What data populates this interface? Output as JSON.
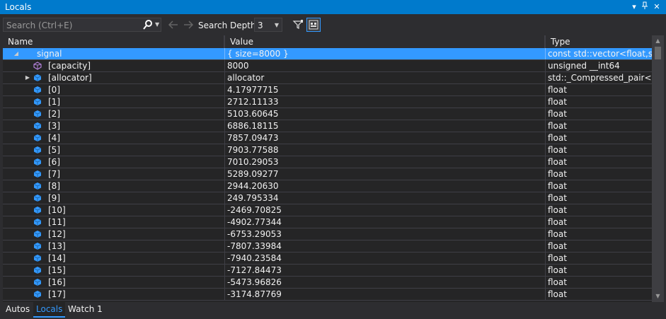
{
  "window": {
    "title": "Locals",
    "controls": [
      "dropdown",
      "pin",
      "close"
    ]
  },
  "toolbar": {
    "search_placeholder": "Search (Ctrl+E)",
    "search_depth_label": "Search Depth:",
    "search_depth_value": "3"
  },
  "columns": {
    "name": "Name",
    "value": "Value",
    "type": "Type"
  },
  "rows": [
    {
      "name": "signal",
      "value": "{ size=8000 }",
      "type": "const std::vector<float,st...",
      "icon": "struct-icon",
      "expander": "expanded",
      "level": 0,
      "selected": true
    },
    {
      "name": "[capacity]",
      "value": "8000",
      "type": "unsigned __int64",
      "icon": "property-icon",
      "expander": "none",
      "level": 1,
      "selected": false
    },
    {
      "name": "[allocator]",
      "value": "allocator",
      "type": "std::_Compressed_pair<st...",
      "icon": "field-icon",
      "expander": "collapsed",
      "level": 1,
      "selected": false
    },
    {
      "name": "[0]",
      "value": "4.17977715",
      "type": "float",
      "icon": "field-icon",
      "expander": "none",
      "level": 1,
      "selected": false
    },
    {
      "name": "[1]",
      "value": "2712.11133",
      "type": "float",
      "icon": "field-icon",
      "expander": "none",
      "level": 1,
      "selected": false
    },
    {
      "name": "[2]",
      "value": "5103.60645",
      "type": "float",
      "icon": "field-icon",
      "expander": "none",
      "level": 1,
      "selected": false
    },
    {
      "name": "[3]",
      "value": "6886.18115",
      "type": "float",
      "icon": "field-icon",
      "expander": "none",
      "level": 1,
      "selected": false
    },
    {
      "name": "[4]",
      "value": "7857.09473",
      "type": "float",
      "icon": "field-icon",
      "expander": "none",
      "level": 1,
      "selected": false
    },
    {
      "name": "[5]",
      "value": "7903.77588",
      "type": "float",
      "icon": "field-icon",
      "expander": "none",
      "level": 1,
      "selected": false
    },
    {
      "name": "[6]",
      "value": "7010.29053",
      "type": "float",
      "icon": "field-icon",
      "expander": "none",
      "level": 1,
      "selected": false
    },
    {
      "name": "[7]",
      "value": "5289.09277",
      "type": "float",
      "icon": "field-icon",
      "expander": "none",
      "level": 1,
      "selected": false
    },
    {
      "name": "[8]",
      "value": "2944.20630",
      "type": "float",
      "icon": "field-icon",
      "expander": "none",
      "level": 1,
      "selected": false
    },
    {
      "name": "[9]",
      "value": "249.795334",
      "type": "float",
      "icon": "field-icon",
      "expander": "none",
      "level": 1,
      "selected": false
    },
    {
      "name": "[10]",
      "value": "-2469.70825",
      "type": "float",
      "icon": "field-icon",
      "expander": "none",
      "level": 1,
      "selected": false
    },
    {
      "name": "[11]",
      "value": "-4902.77344",
      "type": "float",
      "icon": "field-icon",
      "expander": "none",
      "level": 1,
      "selected": false
    },
    {
      "name": "[12]",
      "value": "-6753.29053",
      "type": "float",
      "icon": "field-icon",
      "expander": "none",
      "level": 1,
      "selected": false
    },
    {
      "name": "[13]",
      "value": "-7807.33984",
      "type": "float",
      "icon": "field-icon",
      "expander": "none",
      "level": 1,
      "selected": false
    },
    {
      "name": "[14]",
      "value": "-7940.23584",
      "type": "float",
      "icon": "field-icon",
      "expander": "none",
      "level": 1,
      "selected": false
    },
    {
      "name": "[15]",
      "value": "-7127.84473",
      "type": "float",
      "icon": "field-icon",
      "expander": "none",
      "level": 1,
      "selected": false
    },
    {
      "name": "[16]",
      "value": "-5473.96826",
      "type": "float",
      "icon": "field-icon",
      "expander": "none",
      "level": 1,
      "selected": false
    },
    {
      "name": "[17]",
      "value": "-3174.87769",
      "type": "float",
      "icon": "field-icon",
      "expander": "none",
      "level": 1,
      "selected": false
    }
  ],
  "tabs": [
    {
      "label": "Autos",
      "active": false
    },
    {
      "label": "Locals",
      "active": true
    },
    {
      "label": "Watch 1",
      "active": false
    }
  ],
  "colors": {
    "accent": "#007acc",
    "selection": "#3399ff",
    "background": "#252526",
    "chrome": "#2d2d30",
    "struct_icon": "#3399ff",
    "property_icon": "#b180d7",
    "field_icon": "#3399ff"
  }
}
